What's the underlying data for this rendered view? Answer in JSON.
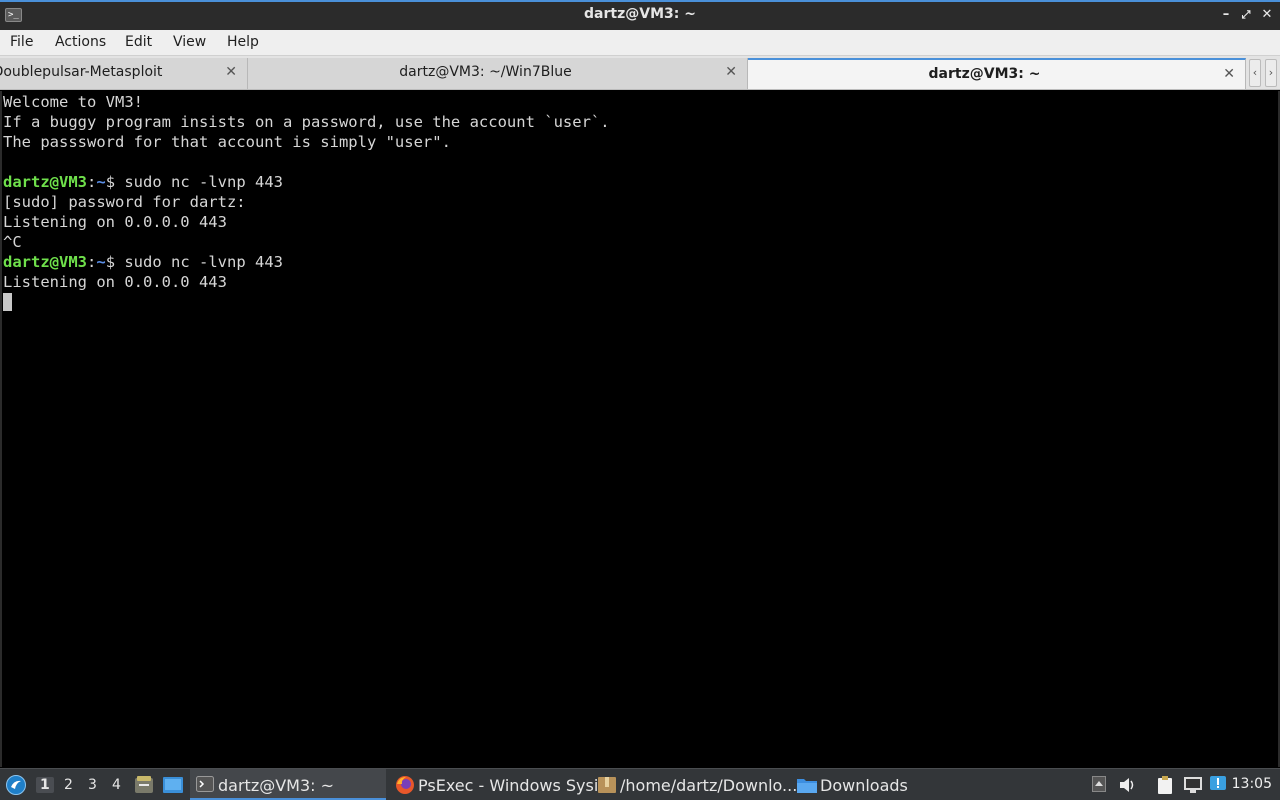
{
  "window": {
    "title": "dartz@VM3: ~",
    "icon": "terminal-icon",
    "controls": {
      "minimize": "minimize-icon",
      "maximize": "maximize-icon",
      "close": "close-icon"
    }
  },
  "menu": [
    "File",
    "Actions",
    "Edit",
    "View",
    "Help"
  ],
  "tabs": [
    {
      "label": "Doublepulsar-Metasploit",
      "active": false
    },
    {
      "label": "dartz@VM3: ~/Win7Blue",
      "active": false
    },
    {
      "label": "dartz@VM3: ~",
      "active": true
    }
  ],
  "terminal": {
    "lines": [
      {
        "text": "Welcome to VM3!"
      },
      {
        "text": "If a buggy program insists on a password, use the account `user`."
      },
      {
        "text": "The passsword for that account is simply \"user\"."
      },
      {
        "text": ""
      },
      {
        "user": "dartz@VM3",
        "sep": ":",
        "path": "~",
        "cmd": "$ sudo nc -lvnp 443"
      },
      {
        "text": "[sudo] password for dartz:"
      },
      {
        "text": "Listening on 0.0.0.0 443"
      },
      {
        "text": "^C"
      },
      {
        "user": "dartz@VM3",
        "sep": ":",
        "path": "~",
        "cmd": "$ sudo nc -lvnp 443"
      },
      {
        "text": "Listening on 0.0.0.0 443"
      }
    ],
    "colors": {
      "background": "#000000",
      "text": "#d6d6d6",
      "user": "#6fe04b",
      "path": "#5b8fe8"
    }
  },
  "taskbar": {
    "workspaces": [
      "1",
      "2",
      "3",
      "4"
    ],
    "active_workspace": "1",
    "tasks": [
      {
        "label": "dartz@VM3: ~",
        "icon": "terminal-icon",
        "active": true
      },
      {
        "label": "PsExec - Windows Sysi...",
        "icon": "firefox-icon",
        "active": false
      },
      {
        "label": "/home/dartz/Downlo...",
        "icon": "archive-icon",
        "active": false
      },
      {
        "label": "Downloads",
        "icon": "folder-icon",
        "active": false
      }
    ],
    "clock": "13:05",
    "accent": "#4a90d9"
  }
}
